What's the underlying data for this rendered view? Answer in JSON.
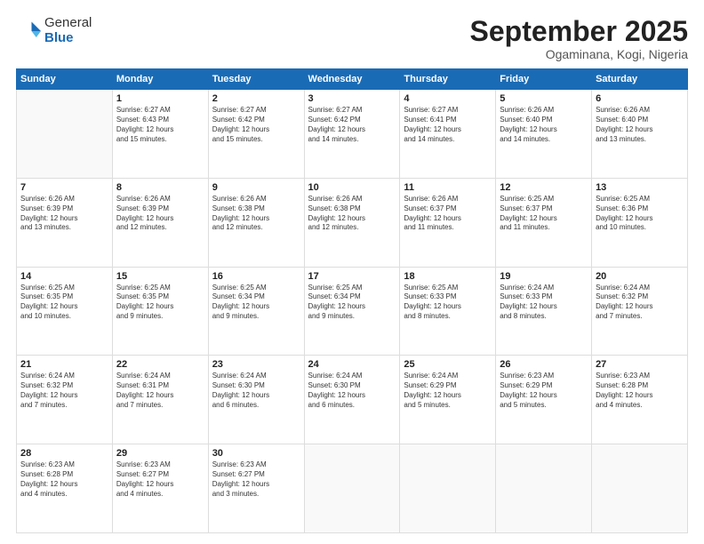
{
  "header": {
    "logo_general": "General",
    "logo_blue": "Blue",
    "month_title": "September 2025",
    "subtitle": "Ogaminana, Kogi, Nigeria"
  },
  "days_of_week": [
    "Sunday",
    "Monday",
    "Tuesday",
    "Wednesday",
    "Thursday",
    "Friday",
    "Saturday"
  ],
  "weeks": [
    [
      {
        "day": "",
        "text": ""
      },
      {
        "day": "1",
        "text": "Sunrise: 6:27 AM\nSunset: 6:43 PM\nDaylight: 12 hours\nand 15 minutes."
      },
      {
        "day": "2",
        "text": "Sunrise: 6:27 AM\nSunset: 6:42 PM\nDaylight: 12 hours\nand 15 minutes."
      },
      {
        "day": "3",
        "text": "Sunrise: 6:27 AM\nSunset: 6:42 PM\nDaylight: 12 hours\nand 14 minutes."
      },
      {
        "day": "4",
        "text": "Sunrise: 6:27 AM\nSunset: 6:41 PM\nDaylight: 12 hours\nand 14 minutes."
      },
      {
        "day": "5",
        "text": "Sunrise: 6:26 AM\nSunset: 6:40 PM\nDaylight: 12 hours\nand 14 minutes."
      },
      {
        "day": "6",
        "text": "Sunrise: 6:26 AM\nSunset: 6:40 PM\nDaylight: 12 hours\nand 13 minutes."
      }
    ],
    [
      {
        "day": "7",
        "text": "Sunrise: 6:26 AM\nSunset: 6:39 PM\nDaylight: 12 hours\nand 13 minutes."
      },
      {
        "day": "8",
        "text": "Sunrise: 6:26 AM\nSunset: 6:39 PM\nDaylight: 12 hours\nand 12 minutes."
      },
      {
        "day": "9",
        "text": "Sunrise: 6:26 AM\nSunset: 6:38 PM\nDaylight: 12 hours\nand 12 minutes."
      },
      {
        "day": "10",
        "text": "Sunrise: 6:26 AM\nSunset: 6:38 PM\nDaylight: 12 hours\nand 12 minutes."
      },
      {
        "day": "11",
        "text": "Sunrise: 6:26 AM\nSunset: 6:37 PM\nDaylight: 12 hours\nand 11 minutes."
      },
      {
        "day": "12",
        "text": "Sunrise: 6:25 AM\nSunset: 6:37 PM\nDaylight: 12 hours\nand 11 minutes."
      },
      {
        "day": "13",
        "text": "Sunrise: 6:25 AM\nSunset: 6:36 PM\nDaylight: 12 hours\nand 10 minutes."
      }
    ],
    [
      {
        "day": "14",
        "text": "Sunrise: 6:25 AM\nSunset: 6:35 PM\nDaylight: 12 hours\nand 10 minutes."
      },
      {
        "day": "15",
        "text": "Sunrise: 6:25 AM\nSunset: 6:35 PM\nDaylight: 12 hours\nand 9 minutes."
      },
      {
        "day": "16",
        "text": "Sunrise: 6:25 AM\nSunset: 6:34 PM\nDaylight: 12 hours\nand 9 minutes."
      },
      {
        "day": "17",
        "text": "Sunrise: 6:25 AM\nSunset: 6:34 PM\nDaylight: 12 hours\nand 9 minutes."
      },
      {
        "day": "18",
        "text": "Sunrise: 6:25 AM\nSunset: 6:33 PM\nDaylight: 12 hours\nand 8 minutes."
      },
      {
        "day": "19",
        "text": "Sunrise: 6:24 AM\nSunset: 6:33 PM\nDaylight: 12 hours\nand 8 minutes."
      },
      {
        "day": "20",
        "text": "Sunrise: 6:24 AM\nSunset: 6:32 PM\nDaylight: 12 hours\nand 7 minutes."
      }
    ],
    [
      {
        "day": "21",
        "text": "Sunrise: 6:24 AM\nSunset: 6:32 PM\nDaylight: 12 hours\nand 7 minutes."
      },
      {
        "day": "22",
        "text": "Sunrise: 6:24 AM\nSunset: 6:31 PM\nDaylight: 12 hours\nand 7 minutes."
      },
      {
        "day": "23",
        "text": "Sunrise: 6:24 AM\nSunset: 6:30 PM\nDaylight: 12 hours\nand 6 minutes."
      },
      {
        "day": "24",
        "text": "Sunrise: 6:24 AM\nSunset: 6:30 PM\nDaylight: 12 hours\nand 6 minutes."
      },
      {
        "day": "25",
        "text": "Sunrise: 6:24 AM\nSunset: 6:29 PM\nDaylight: 12 hours\nand 5 minutes."
      },
      {
        "day": "26",
        "text": "Sunrise: 6:23 AM\nSunset: 6:29 PM\nDaylight: 12 hours\nand 5 minutes."
      },
      {
        "day": "27",
        "text": "Sunrise: 6:23 AM\nSunset: 6:28 PM\nDaylight: 12 hours\nand 4 minutes."
      }
    ],
    [
      {
        "day": "28",
        "text": "Sunrise: 6:23 AM\nSunset: 6:28 PM\nDaylight: 12 hours\nand 4 minutes."
      },
      {
        "day": "29",
        "text": "Sunrise: 6:23 AM\nSunset: 6:27 PM\nDaylight: 12 hours\nand 4 minutes."
      },
      {
        "day": "30",
        "text": "Sunrise: 6:23 AM\nSunset: 6:27 PM\nDaylight: 12 hours\nand 3 minutes."
      },
      {
        "day": "",
        "text": ""
      },
      {
        "day": "",
        "text": ""
      },
      {
        "day": "",
        "text": ""
      },
      {
        "day": "",
        "text": ""
      }
    ]
  ]
}
